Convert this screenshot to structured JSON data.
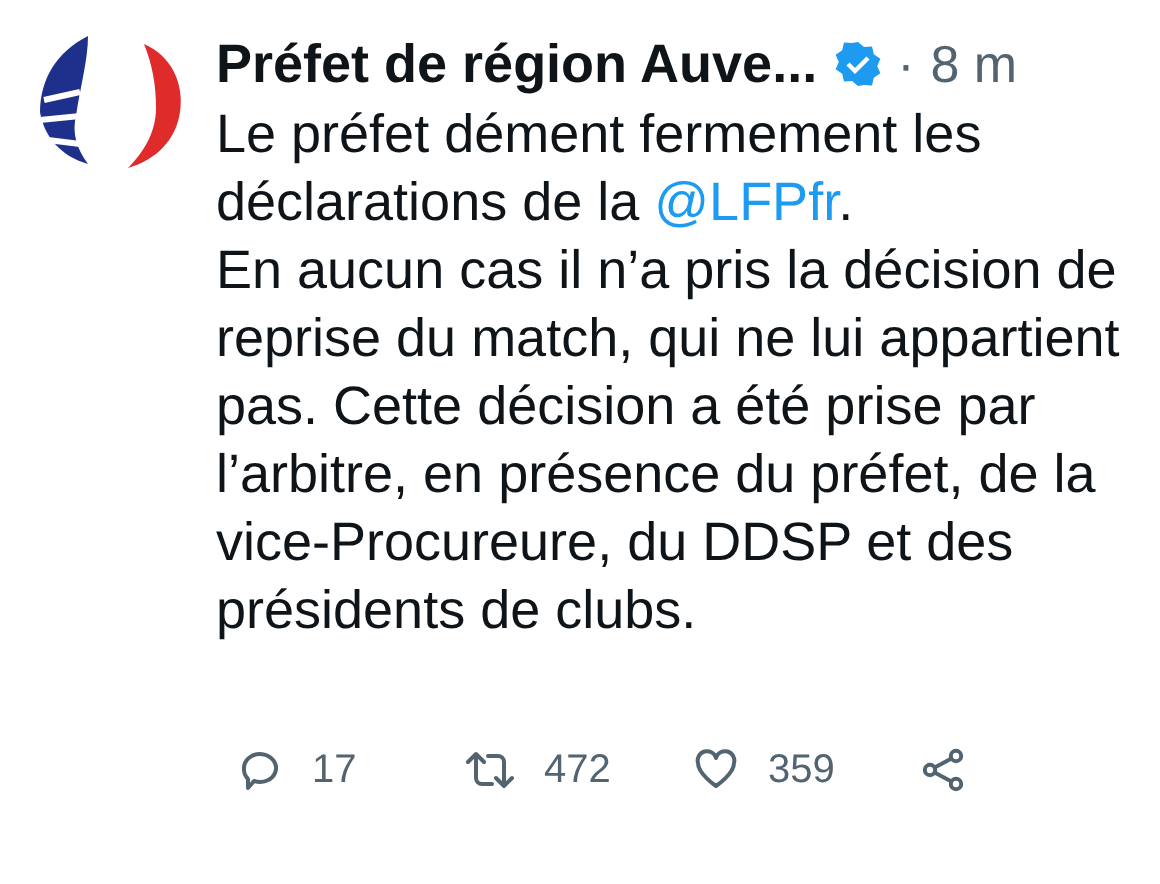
{
  "author": {
    "name": "Préfet de région Auve...",
    "verified": true,
    "separator": "·",
    "time": "8 m"
  },
  "paragraphs": [
    {
      "text": "Le préfet dément fermement les déclarations de la ",
      "mention": "@LFPfr",
      "after": "."
    },
    {
      "text": "En aucun cas il n’a pris la décision de reprise du match, qui ne lui appartient pas. Cette décision a été prise par l’arbitre, en présence du préfet, de la vice-Procureure, du DDSP et des présidents de clubs."
    }
  ],
  "actions": [
    {
      "kind": "reply",
      "count": "17"
    },
    {
      "kind": "retweet",
      "count": "472"
    },
    {
      "kind": "like",
      "count": "359"
    },
    {
      "kind": "share"
    }
  ]
}
